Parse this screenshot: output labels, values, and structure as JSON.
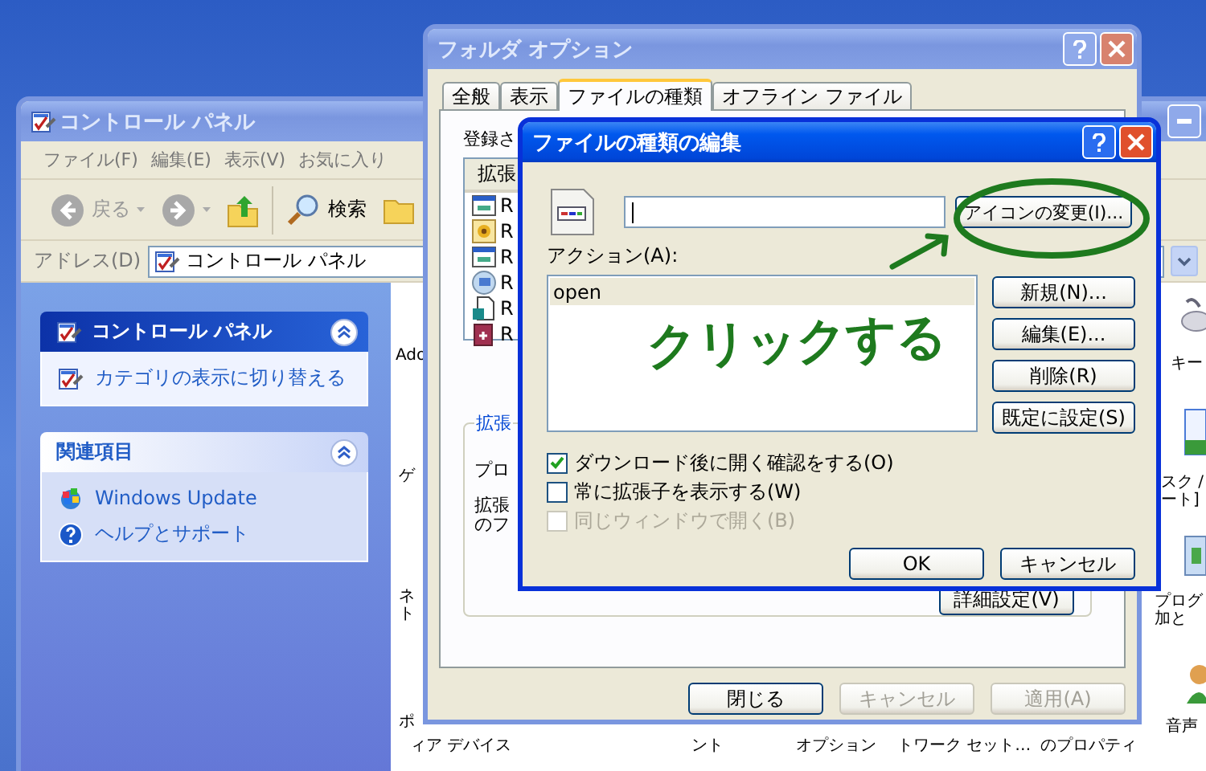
{
  "control_panel": {
    "title": "コントロール パネル",
    "active": false,
    "menu": [
      "ファイル(F)",
      "編集(E)",
      "表示(V)",
      "お気に入り"
    ],
    "toolbar": {
      "back": "戻る",
      "search": "検索"
    },
    "address": {
      "label": "アドレス(D)",
      "value": "コントロール パネル"
    },
    "tasks": [
      {
        "title": "コントロール パネル",
        "kind": "primary",
        "expanded": true,
        "links": [
          "カテゴリの表示に切り替える"
        ]
      },
      {
        "title": "関連項目",
        "kind": "secondary",
        "expanded": true,
        "links": [
          "Windows Update",
          "ヘルプとサポート"
        ]
      }
    ],
    "left_labels": [
      [
        "Ado"
      ],
      [
        "ゲ"
      ],
      [
        "ネ",
        "ト"
      ],
      [
        "ポ"
      ]
    ],
    "bottom_labels": [
      "ィア デバイス",
      "ント",
      "オプション",
      "トワーク セット…",
      "のプロパティ"
    ],
    "right_items": [
      {
        "kind": "mouse",
        "lines": [
          "キー"
        ]
      },
      {
        "kind": "taskbar",
        "lines": [
          "スク /",
          "ート]"
        ]
      },
      {
        "kind": "program",
        "lines": [
          "プログ",
          "加と"
        ]
      },
      {
        "kind": "speech",
        "lines": [
          "音声"
        ]
      }
    ]
  },
  "folder_options": {
    "title": "フォルダ オプション",
    "active": false,
    "tabs": [
      {
        "label": "全般",
        "selected": false
      },
      {
        "label": "表示",
        "selected": false
      },
      {
        "label": "ファイルの種類",
        "selected": true
      },
      {
        "label": "オフライン ファイル",
        "selected": false
      }
    ],
    "list_label": "登録さ",
    "list_header": "拡張",
    "rows": [
      {
        "kind": "app",
        "text": "R"
      },
      {
        "kind": "image",
        "text": "R"
      },
      {
        "kind": "app",
        "text": "R"
      },
      {
        "kind": "network",
        "text": "R"
      },
      {
        "kind": "shortcut",
        "text": "R"
      },
      {
        "kind": "book",
        "text": "R"
      }
    ],
    "group_title": "拡張",
    "group_lines": [
      [
        "プロ"
      ],
      [
        "拡張",
        "のフ"
      ]
    ],
    "advanced_button": "詳細設定(V)",
    "buttons": [
      {
        "label": "閉じる",
        "disabled": false
      },
      {
        "label": "キャンセル",
        "disabled": true
      },
      {
        "label": "適用(A)",
        "disabled": true
      }
    ]
  },
  "edit_dialog": {
    "title": "ファイルの種類の編集",
    "active": true,
    "change_icon_button": "アイコンの変更(I)...",
    "actions_label": "アクション(A):",
    "actions": [
      {
        "label": "open",
        "selected": true
      }
    ],
    "side_buttons": [
      "新規(N)...",
      "編集(E)...",
      "削除(R)",
      "既定に設定(S)"
    ],
    "options": [
      {
        "label": "ダウンロード後に開く確認をする(O)",
        "checked": true,
        "disabled": false
      },
      {
        "label": "常に拡張子を表示する(W)",
        "checked": false,
        "disabled": false
      },
      {
        "label": "同じウィンドウで開く(B)",
        "checked": false,
        "disabled": true
      }
    ],
    "buttons": [
      "OK",
      "キャンセル"
    ]
  },
  "annotation": {
    "text": "クリックする"
  }
}
